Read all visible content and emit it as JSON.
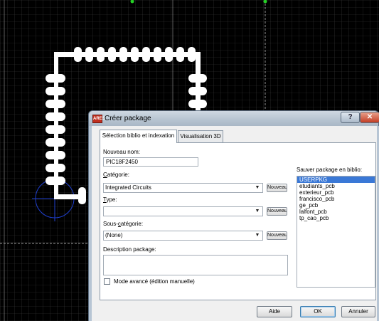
{
  "dialog": {
    "title": "Créer package",
    "help_label": "?",
    "close_label": "✕",
    "tabs": [
      {
        "label": "Sélection biblio et indexation",
        "active": true
      },
      {
        "label": "Visualisation 3D",
        "active": false
      }
    ],
    "new_name": {
      "label": "Nouveau nom:",
      "value": "PIC18F2450"
    },
    "category": {
      "label": "Catégorie:",
      "value": "Integrated Circuits",
      "new_button": "Nouveau"
    },
    "type": {
      "label": "Type:",
      "value": "",
      "new_button": "Nouveau"
    },
    "subcategory": {
      "label": "Sous-catégorie:",
      "value": "(None)",
      "new_button": "Nouveau"
    },
    "description": {
      "label": "Description package:",
      "value": ""
    },
    "advanced_mode": {
      "label": "Mode avancé (édition manuelle)",
      "checked": false
    },
    "save_library": {
      "label": "Sauver package en biblio:",
      "items": [
        "USERPKG",
        "etudiants_pcb",
        "exterieur_pcb",
        "francisco_pcb",
        "ge_pcb",
        "lalfont_pcb",
        "tp_cao_pcb"
      ],
      "selected": "USERPKG"
    },
    "buttons": {
      "help": "Aide",
      "ok": "OK",
      "cancel": "Annuler"
    }
  },
  "colors": {
    "background": "#000000",
    "grid": "#3a3a3a",
    "pad": "#ffffff",
    "origin": "#1f3fd0",
    "titlebar": "#b6c3d0"
  }
}
